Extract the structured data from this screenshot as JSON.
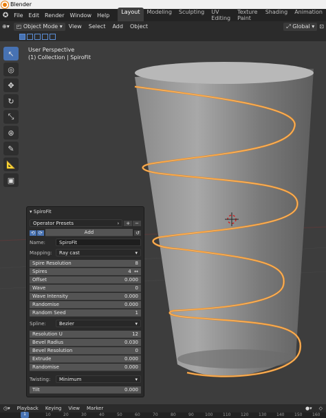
{
  "window": {
    "title": "Blender"
  },
  "menu": {
    "items": [
      "File",
      "Edit",
      "Render",
      "Window",
      "Help"
    ],
    "workspaces": [
      "Layout",
      "Modeling",
      "Sculpting",
      "UV Editing",
      "Texture Paint",
      "Shading",
      "Animation"
    ],
    "active_workspace": "Layout"
  },
  "header": {
    "mode": "Object Mode",
    "items": [
      "View",
      "Select",
      "Add",
      "Object"
    ],
    "transform_orientation": "Global"
  },
  "viewport": {
    "perspective": "User Perspective",
    "collection_line": "(1) Collection | SpiroFit"
  },
  "panel": {
    "title": "SpiroFit",
    "operator_presets": "Operator Presets",
    "add_label": "Add",
    "name_label": "Name:",
    "name_value": "SpiroFit",
    "mapping_label": "Mapping:",
    "mapping_value": "Ray cast",
    "fields1": [
      {
        "label": "Spire Resolution",
        "value": "8"
      },
      {
        "label": "Spires",
        "value": "4"
      },
      {
        "label": "Offset",
        "value": "0.000"
      },
      {
        "label": "Wave",
        "value": "0"
      },
      {
        "label": "Wave Intensity",
        "value": "0.000"
      },
      {
        "label": "Randomise",
        "value": "0.000"
      },
      {
        "label": "Random Seed",
        "value": "1"
      }
    ],
    "spline_label": "Spline:",
    "spline_value": "Bezier",
    "fields2": [
      {
        "label": "Resolution U",
        "value": "12"
      },
      {
        "label": "Bevel Radius",
        "value": "0.030"
      },
      {
        "label": "Bevel Resolution",
        "value": "0"
      },
      {
        "label": "Extrude",
        "value": "0.000"
      },
      {
        "label": "Randomise",
        "value": "0.000"
      }
    ],
    "twisting_label": "Twisting:",
    "twisting_value": "Minimum",
    "tilt_label": "Tilt",
    "tilt_value": "0.000"
  },
  "timeline": {
    "items": [
      "Playback",
      "Keying",
      "View",
      "Marker"
    ],
    "current_frame": "1",
    "ruler": [
      "10",
      "20",
      "30",
      "40",
      "50",
      "60",
      "70",
      "80",
      "90",
      "100",
      "110",
      "120",
      "130",
      "140",
      "150",
      "160"
    ]
  },
  "colors": {
    "accent": "#4772b3",
    "spiral": "#e8912d",
    "viewport": "#3d3d3d"
  }
}
